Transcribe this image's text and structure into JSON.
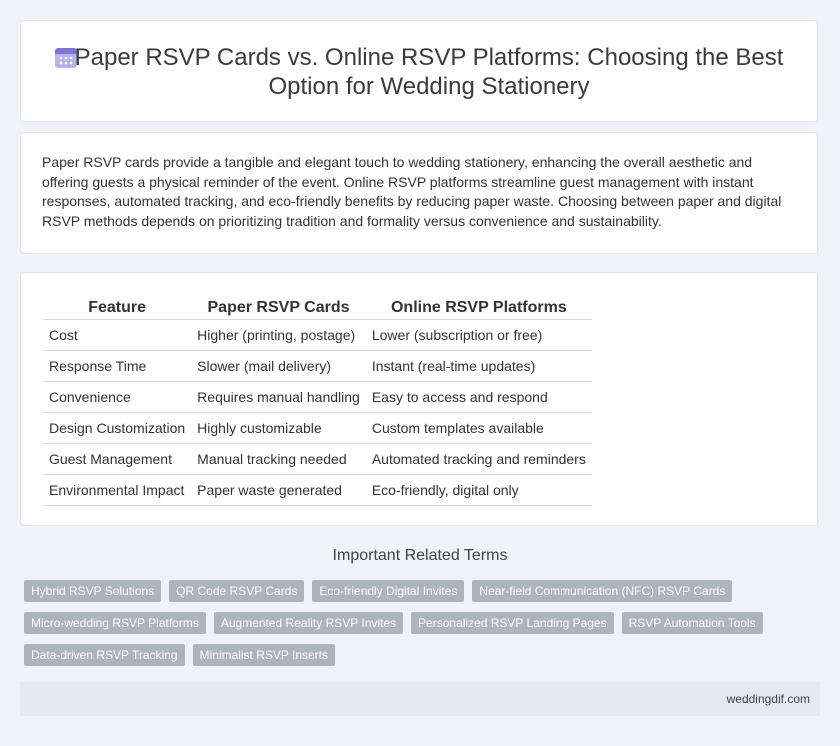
{
  "header": {
    "icon": "calendar-icon",
    "title": "Paper RSVP Cards vs. Online RSVP Platforms: Choosing the Best Option for Wedding Stationery"
  },
  "intro": "Paper RSVP cards provide a tangible and elegant touch to wedding stationery, enhancing the overall aesthetic and offering guests a physical reminder of the event. Online RSVP platforms streamline guest management with instant responses, automated tracking, and eco-friendly benefits by reducing paper waste. Choosing between paper and digital RSVP methods depends on prioritizing tradition and formality versus convenience and sustainability.",
  "table": {
    "headers": [
      "Feature",
      "Paper RSVP Cards",
      "Online RSVP Platforms"
    ],
    "rows": [
      [
        "Cost",
        "Higher (printing, postage)",
        "Lower (subscription or free)"
      ],
      [
        "Response Time",
        "Slower (mail delivery)",
        "Instant (real-time updates)"
      ],
      [
        "Convenience",
        "Requires manual handling",
        "Easy to access and respond"
      ],
      [
        "Design Customization",
        "Highly customizable",
        "Custom templates available"
      ],
      [
        "Guest Management",
        "Manual tracking needed",
        "Automated tracking and reminders"
      ],
      [
        "Environmental Impact",
        "Paper waste generated",
        "Eco-friendly, digital only"
      ]
    ]
  },
  "terms": {
    "heading": "Important Related Terms",
    "items": [
      "Hybrid RSVP Solutions",
      "QR Code RSVP Cards",
      "Eco-friendly Digital Invites",
      "Near-field Communication (NFC) RSVP Cards",
      "Micro-wedding RSVP Platforms",
      "Augmented Reality RSVP Invites",
      "Personalized RSVP Landing Pages",
      "RSVP Automation Tools",
      "Data-driven RSVP Tracking",
      "Minimalist RSVP Inserts"
    ]
  },
  "footer": {
    "site": "weddingdif.com"
  },
  "colors": {
    "background": "#eff2f8",
    "tag": "#aeb4bc",
    "footer": "#e4e9f4",
    "icon": "#8a7fd8"
  }
}
